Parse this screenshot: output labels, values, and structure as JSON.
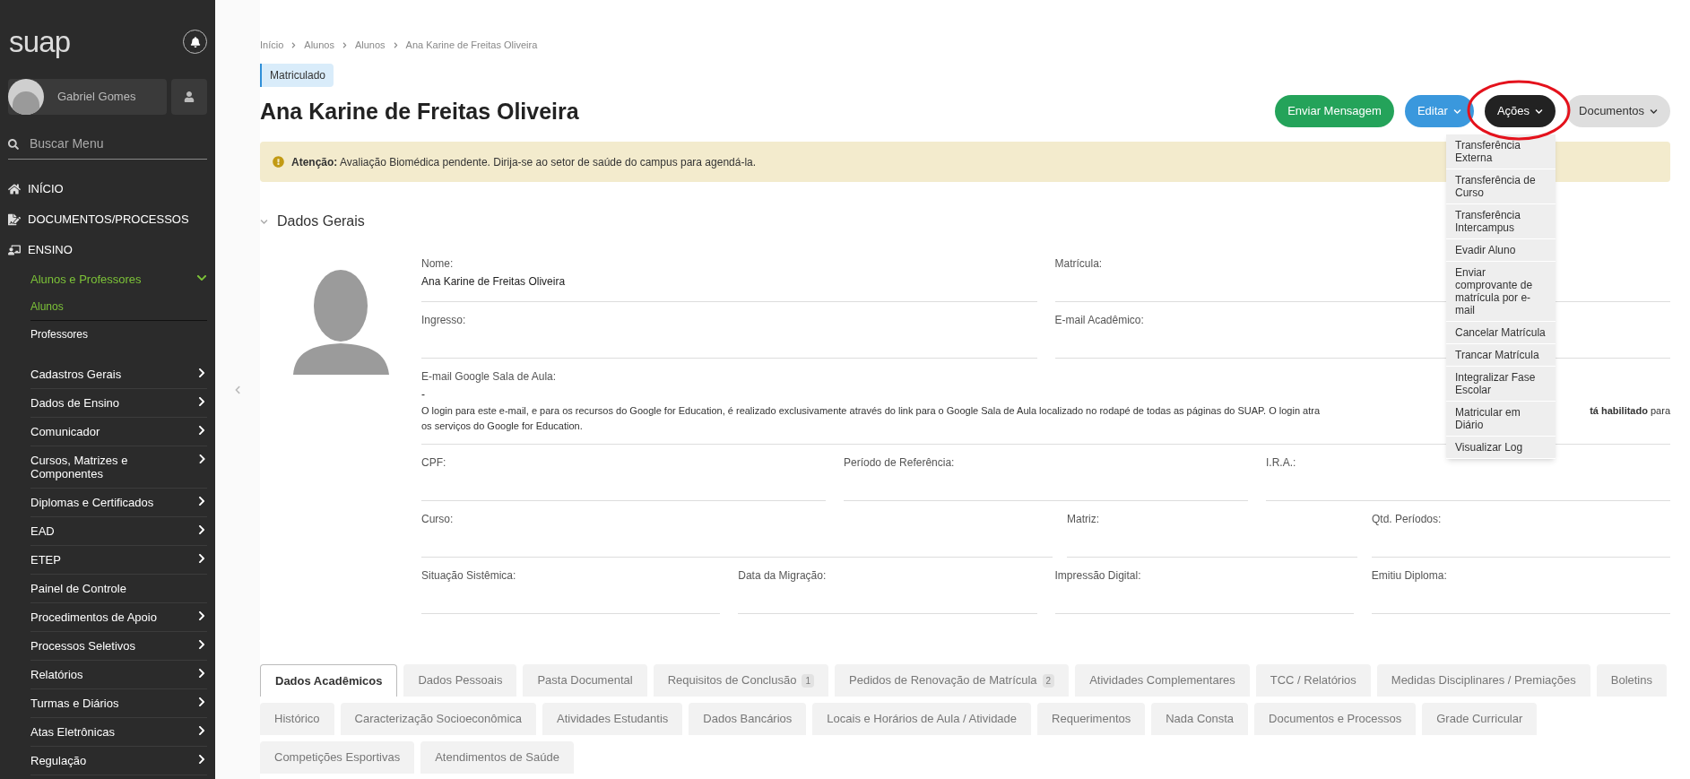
{
  "sidebar": {
    "logo": "suap",
    "user": {
      "name": "Gabriel Gomes"
    },
    "search": {
      "placeholder": "Buscar Menu"
    },
    "modules": [
      {
        "label": "INÍCIO"
      },
      {
        "label": "DOCUMENTOS/PROCESSOS"
      },
      {
        "label": "ENSINO",
        "children": [
          {
            "label": "Alunos e Professores",
            "kind": "group",
            "expanded": true,
            "children": [
              {
                "label": "Alunos",
                "selected": true
              },
              {
                "label": "Professores",
                "selected": false
              }
            ]
          },
          {
            "label": "Cadastros Gerais",
            "kind": "group",
            "expanded": false
          },
          {
            "label": "Dados de Ensino",
            "kind": "group",
            "expanded": false
          },
          {
            "label": "Comunicador",
            "kind": "group",
            "expanded": false
          },
          {
            "label": "Cursos, Matrizes e Componentes",
            "kind": "group",
            "expanded": false
          },
          {
            "label": "Diplomas e Certificados",
            "kind": "group",
            "expanded": false
          },
          {
            "label": "EAD",
            "kind": "group",
            "expanded": false
          },
          {
            "label": "ETEP",
            "kind": "group",
            "expanded": false
          },
          {
            "label": "Painel de Controle",
            "kind": "link"
          },
          {
            "label": "Procedimentos de Apoio",
            "kind": "group",
            "expanded": false
          },
          {
            "label": "Processos Seletivos",
            "kind": "group",
            "expanded": false
          },
          {
            "label": "Relatórios",
            "kind": "group",
            "expanded": false
          },
          {
            "label": "Turmas e Diários",
            "kind": "group",
            "expanded": false
          },
          {
            "label": "Atas Eletrônicas",
            "kind": "group",
            "expanded": false
          },
          {
            "label": "Regulação",
            "kind": "group",
            "expanded": false
          }
        ]
      }
    ]
  },
  "breadcrumb": [
    "Início",
    "Alunos",
    "Alunos",
    "Ana Karine de Freitas Oliveira"
  ],
  "status_badge": "Matriculado",
  "title": "Ana Karine de Freitas Oliveira",
  "actions": [
    {
      "label": "Enviar Mensagem",
      "kind": "button"
    },
    {
      "label": "Editar",
      "kind": "dropdown",
      "expanded": false
    },
    {
      "label": "Ações",
      "kind": "dropdown",
      "expanded": true
    },
    {
      "label": "Documentos",
      "kind": "dropdown",
      "expanded": false
    }
  ],
  "actions_menu": [
    "Transferência Externa",
    "Transferência de Curso",
    "Transferência Intercampus",
    "Evadir Aluno",
    "Enviar comprovante de matrícula por e-mail",
    "Cancelar Matrícula",
    "Trancar Matrícula",
    "Integralizar Fase Escolar",
    "Matricular em Diário",
    "Visualizar Log"
  ],
  "alert": {
    "label": "Atenção:",
    "message": "Avaliação Biomédica pendente. Dirija-se ao setor de saúde do campus para agendá-la."
  },
  "section": {
    "title": "Dados Gerais",
    "expanded": true
  },
  "fields": {
    "row_1": [
      {
        "label": "Nome:",
        "value": "Ana Karine de Freitas Oliveira"
      },
      {
        "label": "Matrícula:"
      }
    ],
    "row_2": [
      {
        "label": "Ingresso:"
      },
      {
        "label": "E-mail Acadêmico:"
      }
    ],
    "google": {
      "label": "E-mail Google Sala de Aula:",
      "value": "-",
      "note_left": "O login para este e-mail, e para os recursos do Google for Education, é realizado exclusivamente através do link para o Google Sala de Aula localizado no rodapé de todas as páginas do SUAP. O login atra",
      "note_right": "**tá habilitado** para",
      "note_line_2": "os serviços do Google for Education."
    },
    "row_3": [
      {
        "label": "CPF:"
      },
      {
        "label": "Período de Referência:"
      },
      {
        "label": "I.R.A.:"
      }
    ],
    "row_4": [
      {
        "label": "Curso:"
      },
      {
        "label": "Matriz:"
      },
      {
        "label": "Qtd. Períodos:"
      }
    ],
    "row_5": [
      {
        "label": "Situação Sistêmica:"
      },
      {
        "label": "Data da Migração:"
      },
      {
        "label": "Impressão Digital:"
      },
      {
        "label": "Emitiu Diploma:"
      }
    ]
  },
  "tabs": [
    {
      "label": "Dados Acadêmicos",
      "selected": true
    },
    {
      "label": "Dados Pessoais",
      "selected": false
    },
    {
      "label": "Pasta Documental",
      "selected": false
    },
    {
      "label": "Requisitos de Conclusão",
      "count": "1",
      "selected": false
    },
    {
      "label": "Pedidos de Renovação de Matrícula",
      "count": "2",
      "selected": false
    },
    {
      "label": "Atividades Complementares",
      "selected": false
    },
    {
      "label": "TCC / Relatórios",
      "selected": false
    },
    {
      "label": "Medidas Disciplinares / Premiações",
      "selected": false
    },
    {
      "label": "Boletins",
      "selected": false
    },
    {
      "label": "Histórico",
      "selected": false
    },
    {
      "label": "Caracterização Socioeconômica",
      "selected": false
    },
    {
      "label": "Atividades Estudantis",
      "selected": false
    },
    {
      "label": "Dados Bancários",
      "selected": false
    },
    {
      "label": "Locais e Horários de Aula / Atividade",
      "selected": false
    },
    {
      "label": "Requerimentos",
      "selected": false
    },
    {
      "label": "Nada Consta",
      "selected": false
    },
    {
      "label": "Documentos e Processos",
      "selected": false
    },
    {
      "label": "Grade Curricular",
      "selected": false
    },
    {
      "label": "Competições Esportivas",
      "selected": false
    },
    {
      "label": "Atendimentos de Saúde",
      "selected": false
    }
  ]
}
